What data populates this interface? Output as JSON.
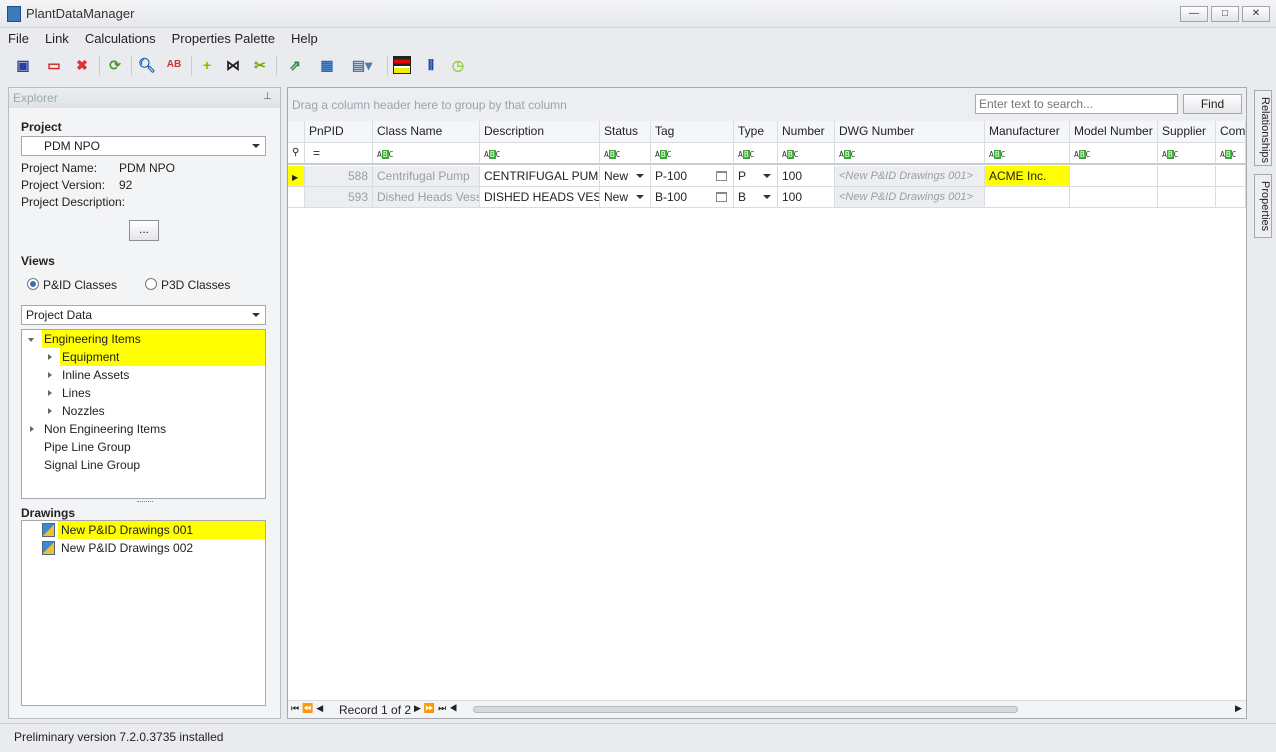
{
  "window": {
    "title": "PlantDataManager",
    "controls": [
      "minimize",
      "maximize",
      "close"
    ]
  },
  "menu": [
    "File",
    "Link",
    "Calculations",
    "Properties Palette",
    "Help"
  ],
  "toolbar": [
    "save-icon",
    "close-document-icon",
    "delete-icon",
    "refresh-icon",
    "find-icon",
    "replace-icon",
    "add-icon",
    "add-connector-icon",
    "split-icon",
    "export-icon",
    "import-icon",
    "table-layout-icon",
    "color-rows-icon",
    "columns-icon",
    "history-icon"
  ],
  "explorer": {
    "title": "Explorer",
    "project_label": "Project",
    "project_value": "PDM NPO",
    "fields": [
      {
        "label": "Project Name:",
        "value": "PDM NPO"
      },
      {
        "label": "Project Version:",
        "value": "92"
      },
      {
        "label": "Project Description:",
        "value": ""
      }
    ],
    "more_button": "...",
    "views_label": "Views",
    "radio_pid": "P&ID Classes",
    "radio_p3d": "P3D Classes",
    "selected_radio": "P&ID Classes",
    "view_combo": "Project Data",
    "tree": [
      {
        "label": "Engineering Items",
        "level": 0,
        "expanded": true,
        "highlight": true
      },
      {
        "label": "Equipment",
        "level": 1,
        "expandable": true,
        "highlight": true
      },
      {
        "label": "Inline Assets",
        "level": 1,
        "expandable": true
      },
      {
        "label": "Lines",
        "level": 1,
        "expandable": true
      },
      {
        "label": "Nozzles",
        "level": 1,
        "expandable": true
      },
      {
        "label": "Non Engineering Items",
        "level": 0,
        "expandable": true
      },
      {
        "label": "Pipe Line Group",
        "level": 0
      },
      {
        "label": "Signal Line Group",
        "level": 0
      }
    ],
    "drawings_label": "Drawings",
    "drawings": [
      {
        "label": "New P&ID Drawings 001",
        "highlight": true
      },
      {
        "label": "New P&ID Drawings 002"
      }
    ]
  },
  "grid": {
    "group_hint": "Drag a column header here to group by that column",
    "search_placeholder": "Enter text to search...",
    "find_button": "Find",
    "columns": [
      "PnPID",
      "Class Name",
      "Description",
      "Status",
      "Tag",
      "Type",
      "Number",
      "DWG Number",
      "Manufacturer",
      "Model Number",
      "Supplier",
      "Comm"
    ],
    "filter_pnpid": "=",
    "rows": [
      [
        "588",
        "Centrifugal Pump",
        "CENTRIFUGAL PUMP",
        "New",
        "P-100",
        "P",
        "100",
        "<New P&ID Drawings 001>",
        "ACME Inc.",
        "",
        "",
        ""
      ],
      [
        "593",
        "Dished Heads Vessel",
        "DISHED HEADS VESSEL",
        "New",
        "B-100",
        "B",
        "100",
        "<New P&ID Drawings 001>",
        "",
        "",
        "",
        ""
      ]
    ],
    "highlight_color": "#ffff00",
    "record_text": "Record 1 of 2"
  },
  "side_tabs": [
    "Relationships",
    "Properties"
  ],
  "status": "Preliminary version 7.2.0.3735 installed"
}
